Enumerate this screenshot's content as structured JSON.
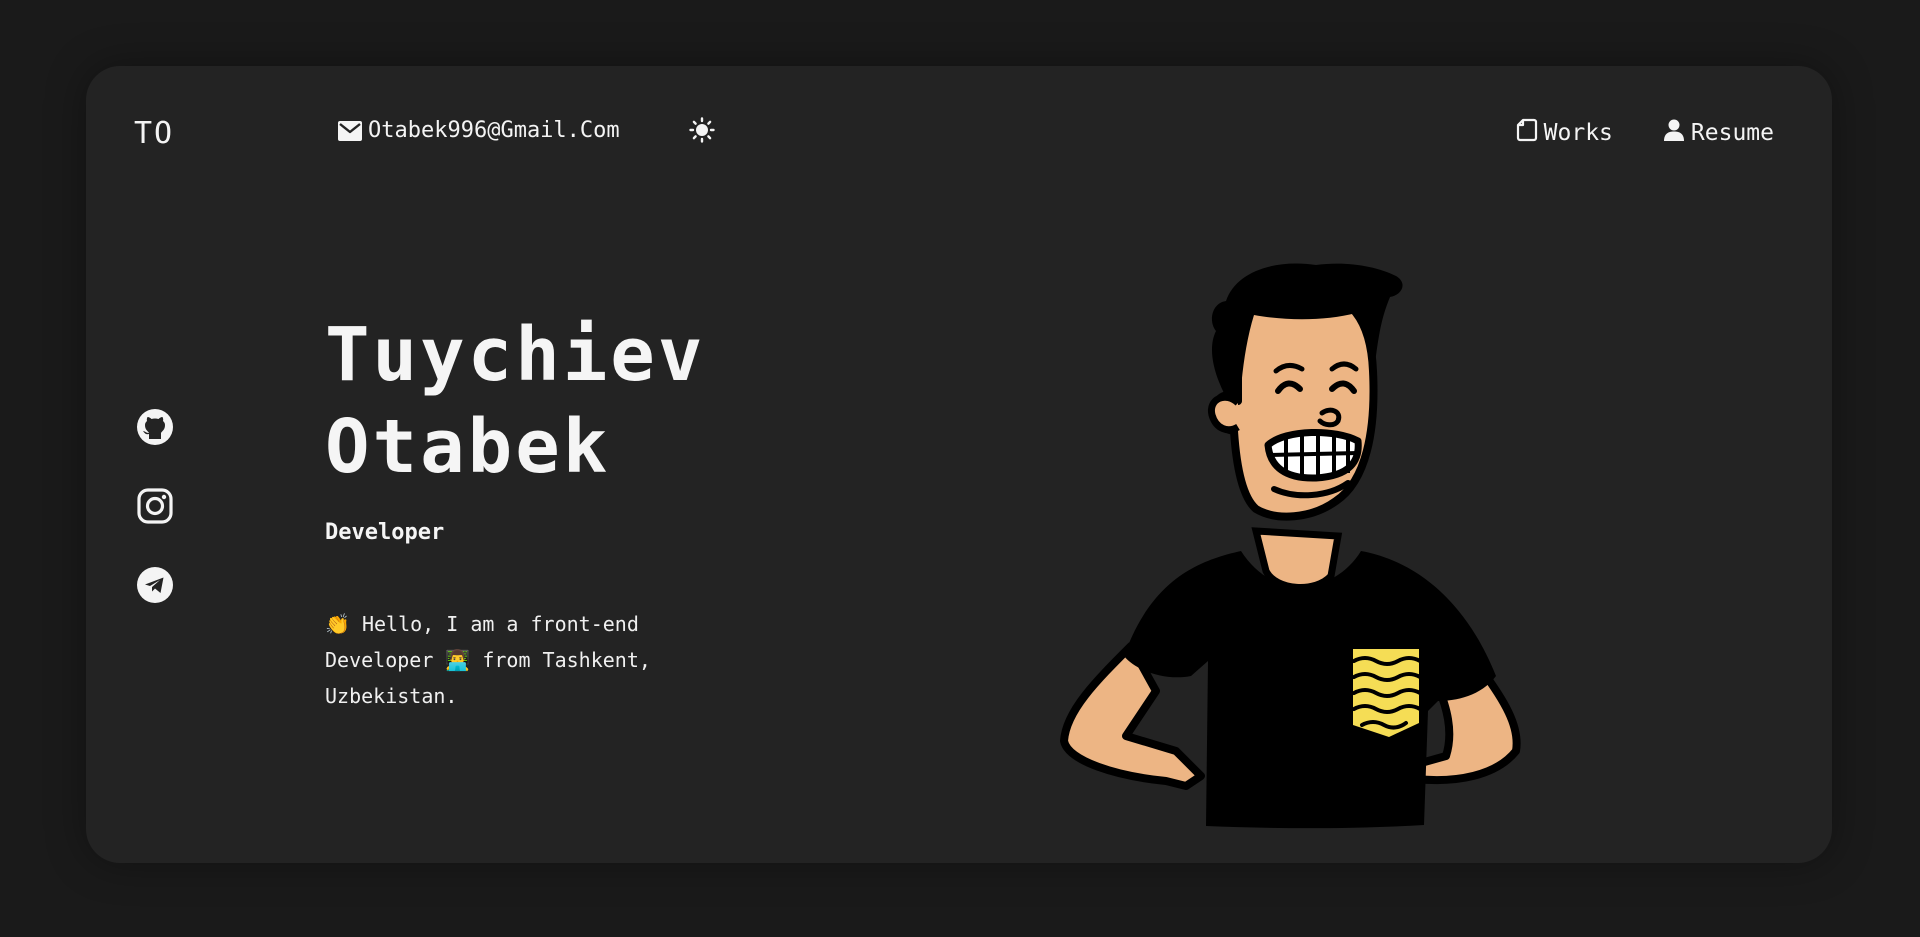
{
  "header": {
    "logo": "TO",
    "email": "Otabek996@Gmail.Com",
    "email_icon": "mail-icon",
    "theme_icon": "sun-icon",
    "nav": [
      {
        "label": "Works",
        "icon": "document-icon"
      },
      {
        "label": "Resume",
        "icon": "user-icon"
      }
    ]
  },
  "social": [
    {
      "icon": "github-icon"
    },
    {
      "icon": "instagram-icon"
    },
    {
      "icon": "telegram-icon"
    }
  ],
  "hero": {
    "first_name": "Tuychiev",
    "last_name": "Otabek",
    "role": "Developer",
    "intro": "👏 Hello, I am a front-end Developer 👨‍💻 from Tashkent, Uzbekistan."
  },
  "colors": {
    "page_bg": "#1a1a1a",
    "card_bg": "#232323",
    "text": "#f4f4f4",
    "skin": "#EDB584",
    "pocket": "#F5DD55"
  }
}
